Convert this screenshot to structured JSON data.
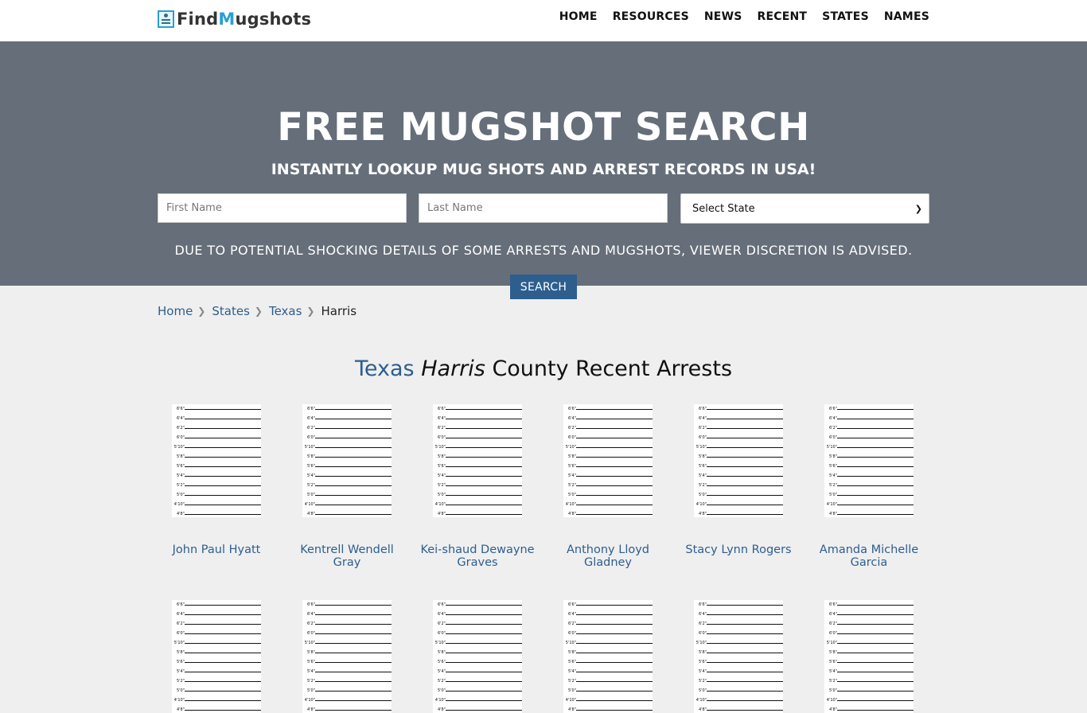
{
  "brand": {
    "logo_find": "Find",
    "logo_m": "M",
    "logo_rest": "ugshots"
  },
  "nav": [
    "HOME",
    "RESOURCES",
    "NEWS",
    "RECENT",
    "STATES",
    "NAMES"
  ],
  "hero": {
    "title": "FREE MUGSHOT SEARCH",
    "subtitle": "INSTANTLY LOOKUP MUG SHOTS AND ARREST RECORDS IN USA!",
    "first_name_placeholder": "First Name",
    "last_name_placeholder": "Last Name",
    "state_select_value": "Select State",
    "advisory": "DUE TO POTENTIAL SHOCKING DETAILS OF SOME ARRESTS AND MUGSHOTS, VIEWER DISCRETION IS ADVISED.",
    "search_label": "SEARCH"
  },
  "breadcrumb": {
    "home": "Home",
    "states": "States",
    "state": "Texas",
    "current": "Harris"
  },
  "section": {
    "state": "Texas",
    "county": "Harris",
    "rest": "County Recent Arrests"
  },
  "height_labels": [
    "6'6\"",
    "6'4\"",
    "6'2\"",
    "6'0\"",
    "5'10\"",
    "5'8\"",
    "5'6\"",
    "5'4\"",
    "5'2\"",
    "5'0\"",
    "4'10\"",
    "4'8\""
  ],
  "arrests": [
    {
      "name": "John Paul Hyatt"
    },
    {
      "name": "Kentrell Wendell Gray"
    },
    {
      "name": "Kei-shaud Dewayne Graves"
    },
    {
      "name": "Anthony Lloyd Gladney"
    },
    {
      "name": "Stacy Lynn Rogers"
    },
    {
      "name": "Amanda Michelle Garcia"
    }
  ]
}
